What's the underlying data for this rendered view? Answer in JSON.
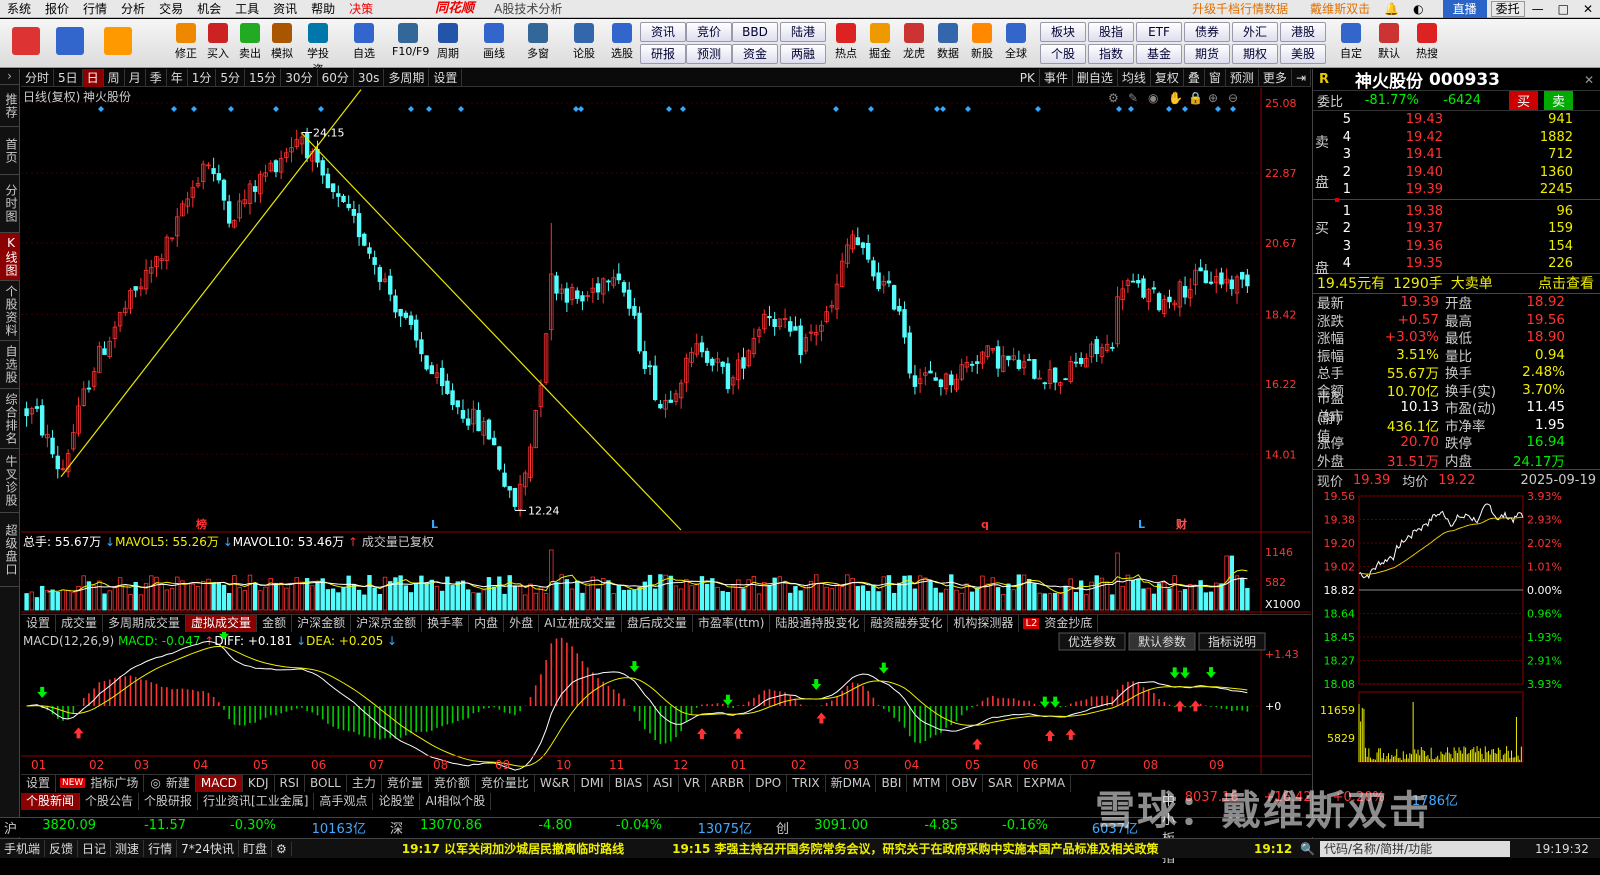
{
  "menu": {
    "items": [
      "系统",
      "报价",
      "行情",
      "分析",
      "交易",
      "机会",
      "工具",
      "资讯",
      "帮助"
    ],
    "decide": "决策",
    "brand": "同花顺",
    "sub": "A股技术分析",
    "promo1": "升级千档行情数据",
    "promo2": "戴维斯双击",
    "live": "直播",
    "login": "委托"
  },
  "toolbar": {
    "buttons": [
      {
        "label": "",
        "icon": "ths-logo-icon"
      },
      {
        "label": "",
        "icon": "robot-icon"
      },
      {
        "label": "",
        "icon": "back-arrow-icon"
      },
      {
        "label": "修正",
        "icon": "up-down-arrow-icon"
      },
      {
        "label": "买入",
        "icon": "buy-icon"
      },
      {
        "label": "卖出",
        "icon": "sell-icon"
      },
      {
        "label": "模拟",
        "icon": "hammer-icon"
      },
      {
        "label": "学投资",
        "icon": "graduation-icon"
      },
      {
        "label": "自选",
        "icon": "star-icon"
      },
      {
        "label": "F10/F9",
        "icon": "f10-icon"
      },
      {
        "label": "周期",
        "icon": "clock-icon"
      },
      {
        "label": "画线",
        "icon": "pen-icon"
      },
      {
        "label": "多窗",
        "icon": "window-icon"
      },
      {
        "label": "论股",
        "icon": "discuss-icon"
      },
      {
        "label": "选股",
        "icon": "select-icon"
      }
    ],
    "small": [
      [
        "资讯",
        "研报"
      ],
      [
        "竞价",
        "预测"
      ],
      [
        "BBD",
        "资金"
      ],
      [
        "陆港",
        "两融"
      ]
    ],
    "buttons2": [
      {
        "label": "热点",
        "icon": "fire-icon"
      },
      {
        "label": "掘金",
        "icon": "gold-icon"
      },
      {
        "label": "龙虎",
        "icon": "dragon-icon"
      },
      {
        "label": "数据",
        "icon": "pe-icon"
      },
      {
        "label": "新股",
        "icon": "newstock-icon"
      },
      {
        "label": "全球",
        "icon": "globe-icon"
      }
    ],
    "small2": [
      [
        "板块",
        "个股"
      ],
      [
        "股指",
        "指数"
      ],
      [
        "ETF",
        "基金"
      ],
      [
        "债券",
        "期货"
      ],
      [
        "外汇",
        "期权"
      ],
      [
        "港股",
        "美股"
      ]
    ],
    "buttons3": [
      {
        "label": "自定",
        "icon": "custom-icon"
      },
      {
        "label": "默认",
        "icon": "home-icon"
      },
      {
        "label": "热搜",
        "icon": "hotsearch-icon"
      }
    ]
  },
  "leftbar": [
    "推荐",
    "首页",
    "分时图",
    "K线图",
    "个股资料",
    "自选股",
    "综合排名",
    "牛叉诊股",
    "超级盘口"
  ],
  "periods": [
    "分时",
    "5日",
    "日",
    "周",
    "月",
    "季",
    "年",
    "1分",
    "5分",
    "15分",
    "30分",
    "60分",
    "30s",
    "多周期",
    "设置"
  ],
  "period_right": [
    "PK",
    "事件",
    "删自选",
    "均线",
    "复权",
    "叠",
    "窗",
    "预测",
    "更多"
  ],
  "chart": {
    "label": "日线(复权)",
    "name": "神火股份",
    "y_ticks": [
      "25.08",
      "22.87",
      "20.67",
      "18.42",
      "16.22",
      "14.01"
    ],
    "high_label": "24.15",
    "low_label": "12.24",
    "markers": [
      {
        "t": "榜",
        "x": 175
      },
      {
        "t": "L",
        "x": 410
      },
      {
        "t": "q",
        "x": 960
      },
      {
        "t": "L",
        "x": 1117
      },
      {
        "t": "财",
        "x": 1155
      }
    ]
  },
  "volume": {
    "label": "总手: 55.67万",
    "mavol5": "MAVOL5: 55.26万",
    "mavol10": "MAVOL10: 53.46万",
    "note": "成交量已复权",
    "ticks": [
      "1146",
      "582",
      "X1000"
    ]
  },
  "ind_tabs": [
    "设置",
    "成交量",
    "多周期成交量",
    "虚拟成交量",
    "金额",
    "沪深金额",
    "沪深京金额",
    "换手率",
    "内盘",
    "外盘",
    "AI立桩成交量",
    "盘后成交量",
    "市盈率(ttm)",
    "陆股通持股变化",
    "融资融券变化",
    "机构探测器",
    "资金抄底"
  ],
  "macd": {
    "label": "MACD(12,26,9)",
    "macd": "MACD: -0.047",
    "diff": "DIFF: +0.181",
    "dea": "DEA: +0.205",
    "btns": [
      "优选参数",
      "默认参数",
      "指标说明"
    ],
    "ticks": [
      "+1.43",
      "+0"
    ]
  },
  "xaxis": [
    "01",
    "02",
    "03",
    "04",
    "05",
    "06",
    "07",
    "08",
    "09",
    "10",
    "11",
    "12",
    "01",
    "02",
    "03",
    "04",
    "05",
    "06",
    "07",
    "08",
    "09"
  ],
  "tabs2": [
    "设置",
    "指标广场",
    "新建",
    "MACD",
    "KDJ",
    "RSI",
    "BOLL",
    "主力",
    "竞价量",
    "竞价额",
    "竞价量比",
    "W&R",
    "DMI",
    "BIAS",
    "ASI",
    "VR",
    "ARBR",
    "DPO",
    "TRIX",
    "新DMA",
    "BBI",
    "MTM",
    "OBV",
    "SAR",
    "EXPMA"
  ],
  "new_badge": "NEW",
  "tabs3": [
    "个股新闻",
    "个股公告",
    "个股研报",
    "行业资讯[工业金属]",
    "高手观点",
    "论股堂",
    "AI相似个股"
  ],
  "quote": {
    "R": "R",
    "name": "神火股份",
    "code": "000933",
    "wb_label": "委比",
    "wb_pct": "-81.77%",
    "wb_val": "-6424",
    "buy": "买",
    "sell": "卖",
    "sells": [
      {
        "lv": "5",
        "p": "19.43",
        "v": "941"
      },
      {
        "lv": "4",
        "p": "19.42",
        "v": "1882"
      },
      {
        "lv": "3",
        "p": "19.41",
        "v": "712"
      },
      {
        "lv": "2",
        "p": "19.40",
        "v": "1360"
      },
      {
        "lv": "1",
        "p": "19.39",
        "v": "2245"
      }
    ],
    "buys": [
      {
        "lv": "1",
        "p": "19.38",
        "v": "96"
      },
      {
        "lv": "2",
        "p": "19.37",
        "v": "159"
      },
      {
        "lv": "3",
        "p": "19.36",
        "v": "154"
      },
      {
        "lv": "4",
        "p": "19.35",
        "v": "226"
      }
    ],
    "sell_side": "卖盘",
    "buy_side": "买盘",
    "bigorder": {
      "a": "19.45元有",
      "b": "1290手",
      "c": "大卖单",
      "d": "点击查看"
    },
    "stats": [
      [
        "最新",
        "19.39",
        "开盘",
        "18.92"
      ],
      [
        "涨跌",
        "+0.57",
        "最高",
        "19.56"
      ],
      [
        "涨幅",
        "+3.03%",
        "最低",
        "18.90"
      ],
      [
        "振幅",
        "3.51%",
        "量比",
        "0.94"
      ],
      [
        "总手",
        "55.67万",
        "换手",
        "2.48%"
      ],
      [
        "金额",
        "10.70亿",
        "换手(实)",
        "3.70%"
      ],
      [
        "市盈(静)",
        "10.13",
        "市盈(动)",
        "11.45"
      ],
      [
        "总市值",
        "436.1亿",
        "市净率",
        "1.95"
      ],
      [
        "涨停",
        "20.70",
        "跌停",
        "16.94"
      ],
      [
        "外盘",
        "31.51万",
        "内盘",
        "24.17万"
      ]
    ]
  },
  "intraday": {
    "now_label": "现价",
    "now": "19.39",
    "avg_label": "均价",
    "avg": "19.22",
    "date": "2025-09-19",
    "left_ticks": [
      "19.56",
      "19.38",
      "19.20",
      "19.02",
      "18.82",
      "18.64",
      "18.45",
      "18.27",
      "18.08"
    ],
    "right_ticks": [
      "3.93%",
      "2.93%",
      "2.02%",
      "1.01%",
      "0.00%",
      "0.96%",
      "1.93%",
      "2.91%",
      "3.93%"
    ],
    "vol_ticks": [
      "11659",
      "5829"
    ]
  },
  "indexbar": [
    {
      "n": "沪",
      "v": "3820.09",
      "c": "-11.57",
      "p": "-0.30%",
      "a": "10163亿"
    },
    {
      "n": "深",
      "v": "13070.86",
      "c": "-4.80",
      "p": "-0.04%",
      "a": "13075亿"
    },
    {
      "n": "创",
      "v": "3091.00",
      "c": "-4.85",
      "p": "-0.16%",
      "a": "6037亿"
    },
    {
      "n": "中小板指",
      "v": "8037.16",
      "c": "+16.42",
      "p": "+0.20%",
      "a": "1786亿"
    }
  ],
  "status": {
    "items": [
      "手机端",
      "反馈",
      "日记",
      "测速",
      "行情",
      "7*24快讯",
      "盯盘"
    ],
    "news1": "19:17 以军关闭加沙城居民撤离临时路线",
    "news2": "19:15 李强主持召开国务院常务会议，研究关于在政府采购中实施本国产品标准及相关政策",
    "time1": "19:12",
    "search": "代码/名称/简拼/功能",
    "clock": "19:19:32"
  },
  "watermark": "雪球：戴维斯双击",
  "colors": {
    "up": "#ff3232",
    "down": "#54fcfc",
    "bg": "#000000",
    "line": "#e8e800"
  }
}
